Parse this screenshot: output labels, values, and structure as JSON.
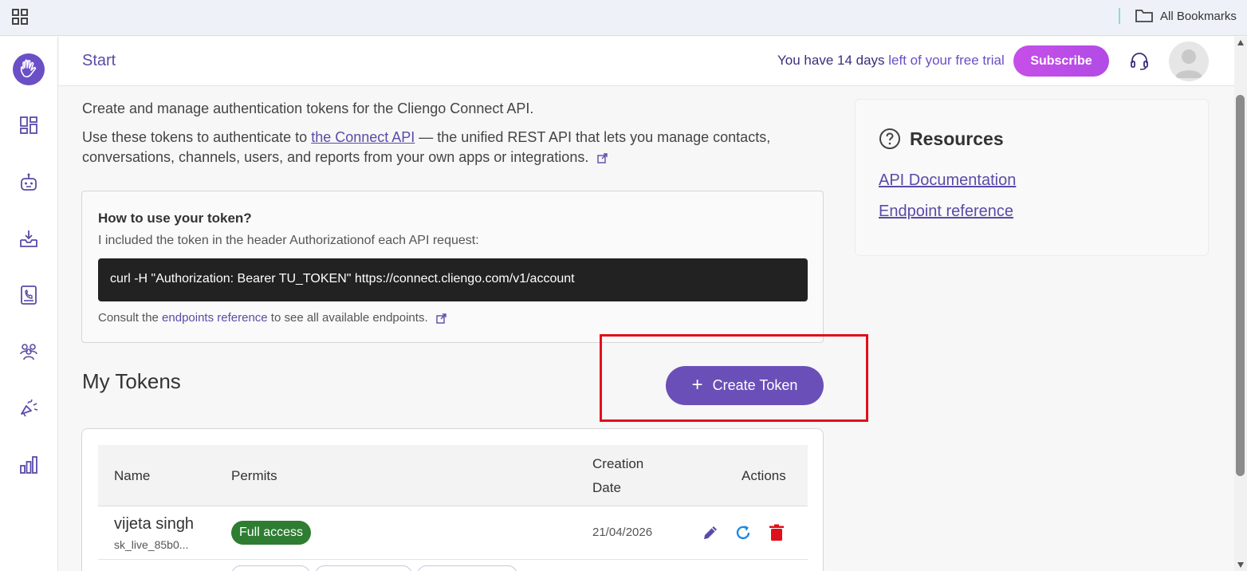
{
  "browser": {
    "all_bookmarks": "All Bookmarks",
    "icons": [
      "apps-grid-icon",
      "folder-icon"
    ]
  },
  "sidebar": {
    "logo": "cliengo-hand-logo",
    "items": [
      {
        "icon": "dashboard-icon"
      },
      {
        "icon": "bot-icon"
      },
      {
        "icon": "inbox-download-icon"
      },
      {
        "icon": "contacts-book-icon"
      },
      {
        "icon": "team-icon"
      },
      {
        "icon": "campaign-megaphone-icon"
      },
      {
        "icon": "bar-chart-icon"
      }
    ]
  },
  "header": {
    "title": "Start",
    "trial_prefix": "You have 14 days",
    "trial_suffix": "left of your free trial",
    "subscribe_label": "Subscribe",
    "support_icon": "headset-icon",
    "avatar_icon": "user-avatar-icon"
  },
  "intro": {
    "line1": "Create and manage authentication tokens for the Cliengo Connect API.",
    "line2_prefix": "Use these tokens to authenticate to ",
    "line2_link": "the Connect API",
    "line2_suffix": " — the unified REST API that lets you manage contacts, conversations, channels, users, and reports from your own apps or integrations."
  },
  "howto": {
    "title": "How to use your token?",
    "description": "I included the token in the header Authorizationof each API request:",
    "code": "curl -H \"Authorization: Bearer TU_TOKEN\" https://connect.cliengo.com/v1/account",
    "consult_prefix": "Consult the ",
    "consult_link": "endpoints reference",
    "consult_suffix": " to see all available endpoints."
  },
  "tokens": {
    "heading": "My Tokens",
    "create_label": "Create Token",
    "columns": [
      "Name",
      "Permits",
      "Creation",
      "Date",
      "Actions"
    ],
    "rows": [
      {
        "name": "vijeta singh",
        "key": "sk_live_85b0...",
        "permit": "Full access",
        "date": "21/04/2026",
        "actions": [
          "edit-icon",
          "refresh-icon",
          "delete-icon"
        ]
      }
    ]
  },
  "resources": {
    "title": "Resources",
    "links": [
      "API Documentation",
      "Endpoint reference"
    ]
  },
  "colors": {
    "primary": "#6a4fb8",
    "subscribe": "#c64fe8",
    "success": "#2e7d32",
    "danger": "#e0101a",
    "code_bg": "#222222"
  }
}
